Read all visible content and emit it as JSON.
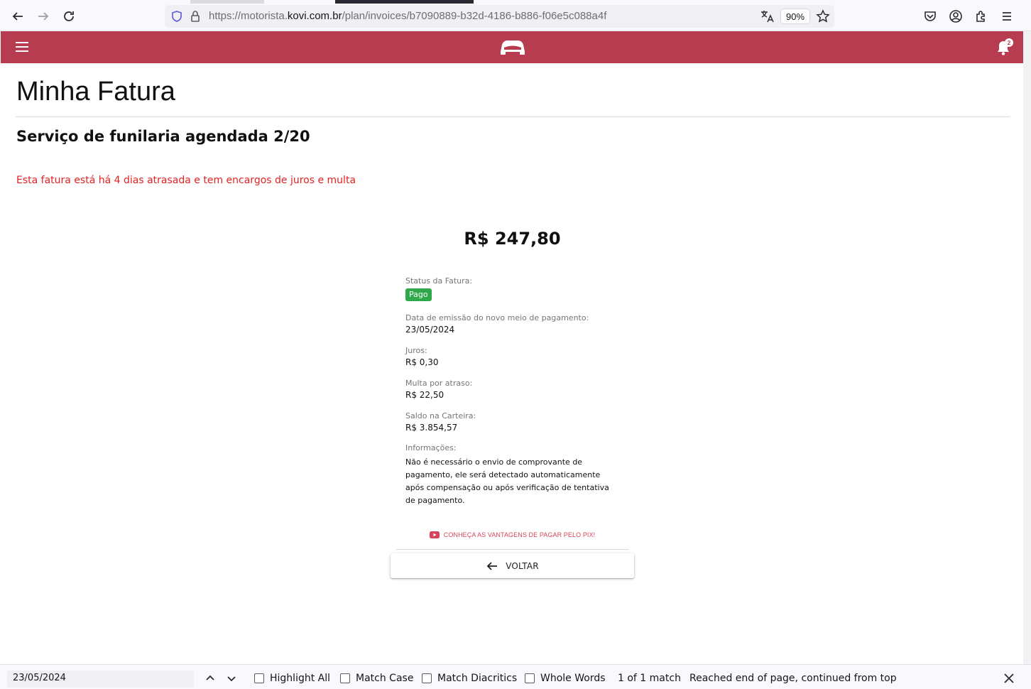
{
  "browser": {
    "url_prefix": "https://motorista.",
    "url_host": "kovi.com.br",
    "url_path": "/plan/invoices/b7090889-b32d-4186-b886-f06e5c088a4f",
    "zoom": "90%"
  },
  "header": {
    "notification_count": "2",
    "brand_color": "#b73c4f"
  },
  "page": {
    "title": "Minha Fatura",
    "subtitle": "Serviço de funilaria agendada 2/20",
    "late_warning": "Esta fatura está há 4 dias atrasada e tem encargos de juros e multa",
    "amount": "R$ 247,80"
  },
  "details": {
    "status_label": "Status da Fatura:",
    "status_value": "Pago",
    "emissao_label": "Data de emissão do novo meio de pagamento:",
    "emissao_value": "23/05/2024",
    "juros_label": "Juros:",
    "juros_value": "R$ 0,30",
    "multa_label": "Multa por atraso:",
    "multa_value": "R$ 22,50",
    "saldo_label": "Saldo na Carteira:",
    "saldo_value": "R$ 3.854,57",
    "info_label": "Informações:",
    "info_value": "Não é necessário o envio de comprovante de pagamento, ele será detectado automaticamente após compensação ou após verificação de tentativa de pagamento."
  },
  "actions": {
    "pix_link": "CONHEÇA AS VANTAGENS DE PAGAR PELO PIX!",
    "back_label": "VOLTAR"
  },
  "find_bar": {
    "query": "23/05/2024",
    "highlight_all": "Highlight All",
    "match_case": "Match Case",
    "match_diacritics": "Match Diacritics",
    "whole_words": "Whole Words",
    "match_count": "1 of 1 match",
    "status": "Reached end of page, continued from top"
  }
}
